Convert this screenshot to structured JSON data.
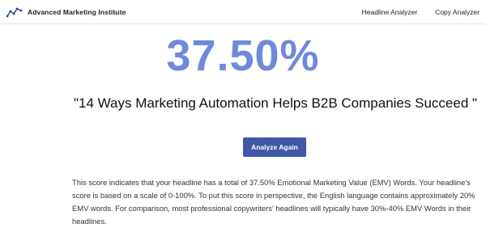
{
  "header": {
    "brand_name": "Advanced Marketing Institute",
    "nav": [
      {
        "label": "Headline Analyzer"
      },
      {
        "label": "Copy Analyzer"
      }
    ]
  },
  "result": {
    "score": "37.50%",
    "headline": "\"14 Ways Marketing Automation Helps B2B Companies Succeed \"",
    "button_label": "Analyze Again",
    "description": "This score indicates that your headline has a total of 37.50% Emotional Marketing Value (EMV) Words. Your headline's score is based on a scale of 0-100%. To put this score in perspective, the English language contains approximately 20% EMV words. For comparison, most professional copywriters' headlines will typically have 30%-40% EMV Words in their headlines."
  },
  "colors": {
    "score": "#6f89db",
    "button": "#3f58a8",
    "logo": "#2f3f8f"
  }
}
